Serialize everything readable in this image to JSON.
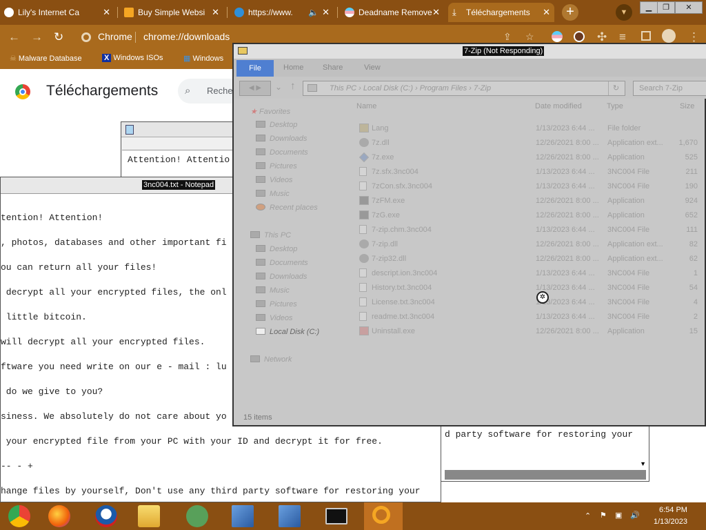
{
  "browser": {
    "tabs": [
      {
        "label": "Lily's Internet Ca",
        "icon": "hacker-icon",
        "icon_color": "#ffffff"
      },
      {
        "label": "Buy Simple Websi",
        "icon": "fox-icon",
        "icon_color": "#f5a623"
      },
      {
        "label": "https://www.",
        "icon": "globe-icon",
        "icon_color": "#2f8fd8"
      },
      {
        "label": "Deadname Remove",
        "icon": "flag-icon",
        "icon_color": "#f4a8c0"
      },
      {
        "label": "Téléchargements",
        "icon": "download-icon",
        "icon_color": "#ffffff"
      }
    ],
    "new_tab_label": "+",
    "url": "chrome://downloads",
    "site_label": "Chrome",
    "bookmarks": [
      "Malware Database",
      "Windows ISOs",
      "Windows"
    ]
  },
  "downloads": {
    "title": "Téléchargements",
    "search_placeholder": "Reche"
  },
  "notepad_small": {
    "text": "Attention! Attentio"
  },
  "notepad": {
    "title": "3nc004.txt - Notepad",
    "lines": [
      "tention! Attention!",
      ", photos, databases and other important fi",
      "ou can return all your files!",
      " decrypt all your encrypted files, the onl",
      " little bitcoin.",
      "will decrypt all your encrypted files.",
      "ftware you need write on our e - mail : lu",
      " do we give to you?",
      "siness. We absolutely do not care about yo",
      " your encrypted file from your PC with your ID and decrypt it for free.",
      "-- - +",
      "hange files by yourself, Don't use any third party software for restoring your"
    ]
  },
  "notepad_back": {
    "text": "d party software for restoring your"
  },
  "explorer": {
    "title": "7-Zip (Not Responding)",
    "ribbon_tabs": [
      "File",
      "Home",
      "Share",
      "View"
    ],
    "breadcrumb": "This PC  ›  Local Disk (C:)  ›  Program Files  ›  7-Zip",
    "search_placeholder": "Search 7-Zip",
    "nav": {
      "favorites_header": "Favorites",
      "favorites": [
        "Desktop",
        "Downloads",
        "Documents",
        "Pictures",
        "Videos",
        "Music",
        "Recent places"
      ],
      "thispc_header": "This PC",
      "thispc": [
        "Desktop",
        "Documents",
        "Downloads",
        "Music",
        "Pictures",
        "Videos",
        "Local Disk (C:)"
      ],
      "network": "Network"
    },
    "columns": {
      "name": "Name",
      "date": "Date modified",
      "type": "Type",
      "size": "Size"
    },
    "files": [
      {
        "name": "Lang",
        "date": "1/13/2023 6:44 ...",
        "type": "File folder",
        "size": "",
        "icon": "folder-icon"
      },
      {
        "name": "7z.dll",
        "date": "12/26/2021 8:00 ...",
        "type": "Application ext...",
        "size": "1,670",
        "icon": "gear-icon"
      },
      {
        "name": "7z.exe",
        "date": "12/26/2021 8:00 ...",
        "type": "Application",
        "size": "525",
        "icon": "app-icon"
      },
      {
        "name": "7z.sfx.3nc004",
        "date": "1/13/2023 6:44 ...",
        "type": "3NC004 File",
        "size": "211",
        "icon": "file-icon"
      },
      {
        "name": "7zCon.sfx.3nc004",
        "date": "1/13/2023 6:44 ...",
        "type": "3NC004 File",
        "size": "190",
        "icon": "file-icon"
      },
      {
        "name": "7zFM.exe",
        "date": "12/26/2021 8:00 ...",
        "type": "Application",
        "size": "924",
        "icon": "sevenzip-icon"
      },
      {
        "name": "7zG.exe",
        "date": "12/26/2021 8:00 ...",
        "type": "Application",
        "size": "652",
        "icon": "sevenzip-icon"
      },
      {
        "name": "7-zip.chm.3nc004",
        "date": "1/13/2023 6:44 ...",
        "type": "3NC004 File",
        "size": "111",
        "icon": "file-icon"
      },
      {
        "name": "7-zip.dll",
        "date": "12/26/2021 8:00 ...",
        "type": "Application ext...",
        "size": "82",
        "icon": "gear-icon"
      },
      {
        "name": "7-zip32.dll",
        "date": "12/26/2021 8:00 ...",
        "type": "Application ext...",
        "size": "62",
        "icon": "gear-icon"
      },
      {
        "name": "descript.ion.3nc004",
        "date": "1/13/2023 6:44 ...",
        "type": "3NC004 File",
        "size": "1",
        "icon": "file-icon"
      },
      {
        "name": "History.txt.3nc004",
        "date": "1/13/2023 6:44 ...",
        "type": "3NC004 File",
        "size": "54",
        "icon": "file-icon"
      },
      {
        "name": "License.txt.3nc004",
        "date": "1/13/2023 6:44 ...",
        "type": "3NC004 File",
        "size": "4",
        "icon": "file-icon"
      },
      {
        "name": "readme.txt.3nc004",
        "date": "1/13/2023 6:44 ...",
        "type": "3NC004 File",
        "size": "2",
        "icon": "file-icon"
      },
      {
        "name": "Uninstall.exe",
        "date": "12/26/2021 8:00 ...",
        "type": "Application",
        "size": "15",
        "icon": "uninstall-icon"
      }
    ],
    "status": "15 items"
  },
  "taskbar": {
    "apps": [
      {
        "name": "chrome-browser",
        "color": "#2b8ae2"
      },
      {
        "name": "firefox",
        "color": "#f0600a"
      },
      {
        "name": "obama-logo",
        "color": "#1c5aa8"
      },
      {
        "name": "file-explorer",
        "color": "#f3c53f"
      },
      {
        "name": "network-app",
        "color": "#58a05a"
      },
      {
        "name": "installer",
        "color": "#3c78c8"
      },
      {
        "name": "installer-2",
        "color": "#3c78c8"
      },
      {
        "name": "command-prompt",
        "color": "#111111"
      },
      {
        "name": "search",
        "color": "#f5a623"
      }
    ],
    "time": "6:54 PM",
    "date": "1/13/2023"
  }
}
